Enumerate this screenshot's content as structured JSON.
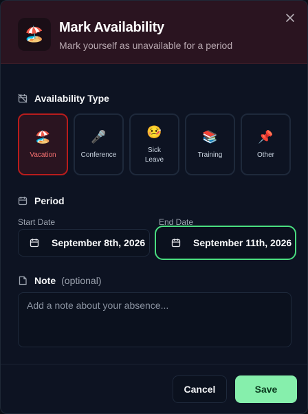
{
  "dialog": {
    "title": "Mark Availability",
    "subtitle": "Mark yourself as unavailable for a period",
    "header_icon": "🏖️"
  },
  "availability": {
    "label": "Availability Type",
    "selected": "Vacation",
    "types": [
      {
        "label": "Vacation",
        "emoji": "🏖️",
        "selected": true
      },
      {
        "label": "Conference",
        "emoji": "🎤",
        "selected": false
      },
      {
        "label": "Sick\nLeave",
        "emoji": "🤒",
        "selected": false
      },
      {
        "label": "Training",
        "emoji": "📚",
        "selected": false
      },
      {
        "label": "Other",
        "emoji": "📌",
        "selected": false
      }
    ]
  },
  "period": {
    "label": "Period",
    "start_label": "Start Date",
    "start_value": "September 8th, 2026",
    "end_label": "End Date",
    "end_value": "September 11th, 2026"
  },
  "note": {
    "label": "Note",
    "optional": "(optional)",
    "placeholder": "Add a note about your absence...",
    "value": ""
  },
  "actions": {
    "cancel_label": "Cancel",
    "save_label": "Save"
  },
  "colors": {
    "selected_border": "#b91c1c",
    "focus_ring": "#4ade80",
    "save_bg": "#86efac"
  }
}
